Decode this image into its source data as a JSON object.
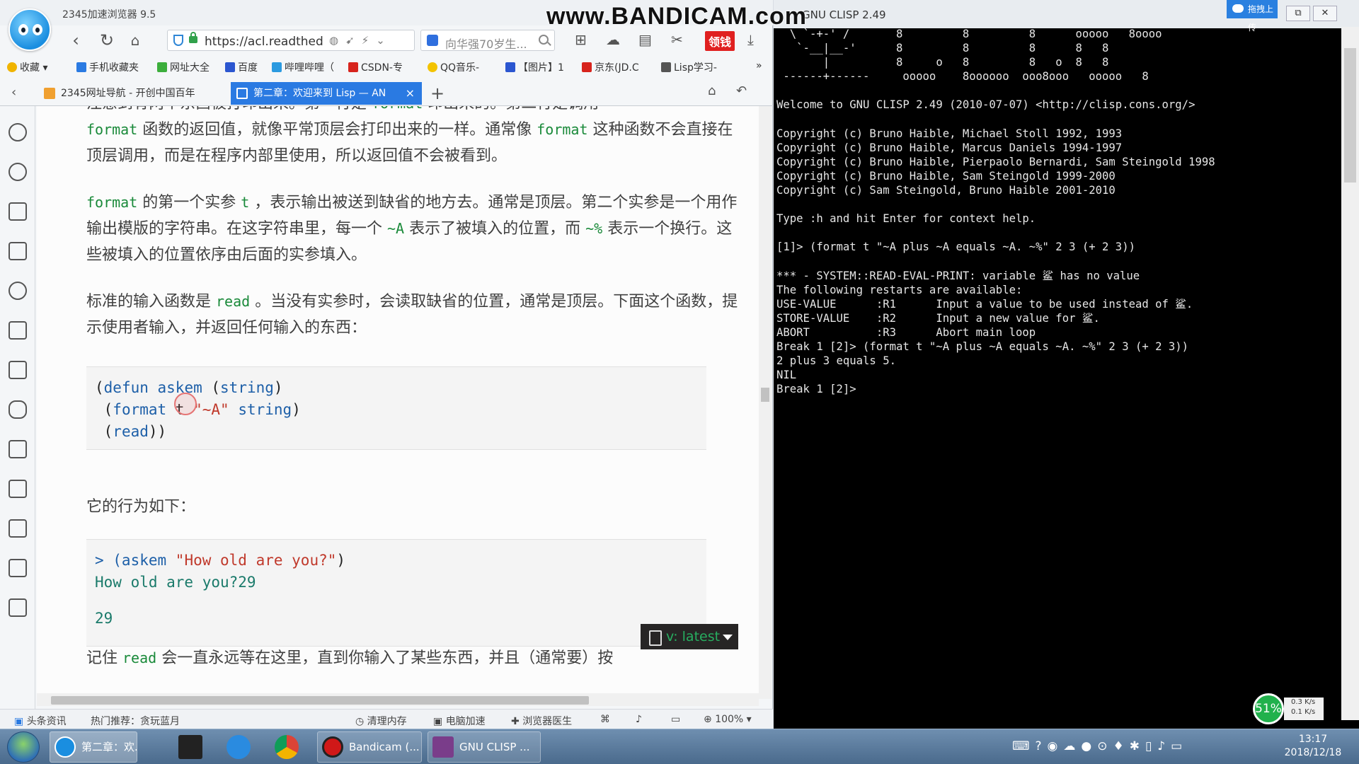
{
  "browser": {
    "app_title": "2345加速浏览器 9.5",
    "url_text": "https://acl.readthed",
    "search_text": "向华强70岁生...",
    "red_tool_label": "领钱",
    "bookmarks": [
      {
        "label": "收藏",
        "color": "#f0b400"
      },
      {
        "label": "手机收藏夹",
        "color": "#2a7ae2"
      },
      {
        "label": "网址大全",
        "color": "#3cae3c"
      },
      {
        "label": "百度",
        "color": "#2b56d0"
      },
      {
        "label": "哔哩哔哩（",
        "color": "#2b9ae0"
      },
      {
        "label": "CSDN-专",
        "color": "#d7241d"
      },
      {
        "label": "QQ音乐-",
        "color": "#f3c300"
      },
      {
        "label": "【图片】1",
        "color": "#2b56d0"
      },
      {
        "label": "京东(JD.C",
        "color": "#d7241d"
      },
      {
        "label": "Lisp学习-",
        "color": "#555555"
      }
    ],
    "tabs": [
      {
        "label": "2345网址导航 - 开创中国百年"
      },
      {
        "label": "第二章：欢迎来到 Lisp — AN"
      }
    ],
    "status": {
      "news": "头条资讯",
      "hot": "热门推荐：贪玩蓝月",
      "clean": "清理内存",
      "speedup": "电脑加速",
      "doctor": "浏览器医生",
      "zoom": "100%"
    }
  },
  "doc": {
    "p1": {
      "a": "注意到有两个东西被打印出来。第一行是",
      "code1": "format",
      "b": "印出来的。第二行是调用",
      "code2": "format",
      "c": "函数的返回值，就像平常顶层会打印出来的一样。通常像",
      "code3": "format",
      "d": "这种函数不会直接在顶层调用，而是在程序内部里使用，所以返回值不会被看到。"
    },
    "p2": {
      "code1": "format",
      "a": "的第一个实参",
      "code2": "t",
      "b": "，表示输出被送到缺省的地方去。通常是顶层。第二个实参是一个用作输出模版的字符串。在这字符串里，每一个",
      "code3": "~A",
      "c": "表示了被填入的位置，而",
      "code4": "~%",
      "d": "表示一个换行。这些被填入的位置依序由后面的实参填入。"
    },
    "p3": {
      "a": "标准的输入函数是",
      "code1": "read",
      "b": "。当没有实参时，会读取缺省的位置，通常是顶层。下面这个函数，提示使用者输入，并返回任何输入的东西："
    },
    "code1": {
      "l1_p1": "(",
      "l1_kw": "defun askem",
      "l1_p2": " (",
      "l1_arg": "string",
      "l1_p3": ")",
      "l2_p1": " (",
      "l2_kw": "format",
      "l2_t": " t ",
      "l2_str": "\"~A\"",
      "l2_arg": " string",
      "l2_p2": ")",
      "l3_p1": " (",
      "l3_kw": "read",
      "l3_p2": "))"
    },
    "p4": "它的行为如下：",
    "code2": {
      "prompt": "> (askem ",
      "str": "\"How old are you?\"",
      "close": ")",
      "out1": "How old are you?29",
      "out2": "29"
    },
    "p5": {
      "code1": "read",
      "a": "记住",
      "b": "会一直永远等在这里，直到你输入了某些东西，并且（通常要）按"
    },
    "version_badge": "v: latest"
  },
  "watermark": "www.BANDICAM.com",
  "terminal": {
    "title": "GNU CLISP 2.49",
    "upload_label": "拖拽上传",
    "text": "  \\ `-+-' /       8         8         8      ooooo   8oooo\n   `-__|__-'      8         8         8      8   8\n       |          8     o   8         8   o  8   8\n ------+------     ooooo    8oooooo  ooo8ooo   ooooo   8\n\nWelcome to GNU CLISP 2.49 (2010-07-07) <http://clisp.cons.org/>\n\nCopyright (c) Bruno Haible, Michael Stoll 1992, 1993\nCopyright (c) Bruno Haible, Marcus Daniels 1994-1997\nCopyright (c) Bruno Haible, Pierpaolo Bernardi, Sam Steingold 1998\nCopyright (c) Bruno Haible, Sam Steingold 1999-2000\nCopyright (c) Sam Steingold, Bruno Haible 2001-2010\n\nType :h and hit Enter for context help.\n\n[1]> (format t \"~A plus ~A equals ~A. ~%\" 2 3 (+ 2 3))\n\n*** - SYSTEM::READ-EVAL-PRINT: variable 鲨 has no value\nThe following restarts are available:\nUSE-VALUE      :R1      Input a value to be used instead of 鲨.\nSTORE-VALUE    :R2      Input a new value for 鲨.\nABORT          :R3      Abort main loop\nBreak 1 [2]> (format t \"~A plus ~A equals ~A. ~%\" 2 3 (+ 2 3))\n2 plus 3 equals 5.\nNIL\nBreak 1 [2]>",
    "net_percent": "51%",
    "net_up": "0.3 K/s",
    "net_down": "0.1 K/s"
  },
  "taskbar": {
    "task1": "第二章：欢...",
    "task2": "Bandicam (...",
    "task3": "GNU CLISP ...",
    "time": "13:17",
    "date": "2018/12/18"
  }
}
